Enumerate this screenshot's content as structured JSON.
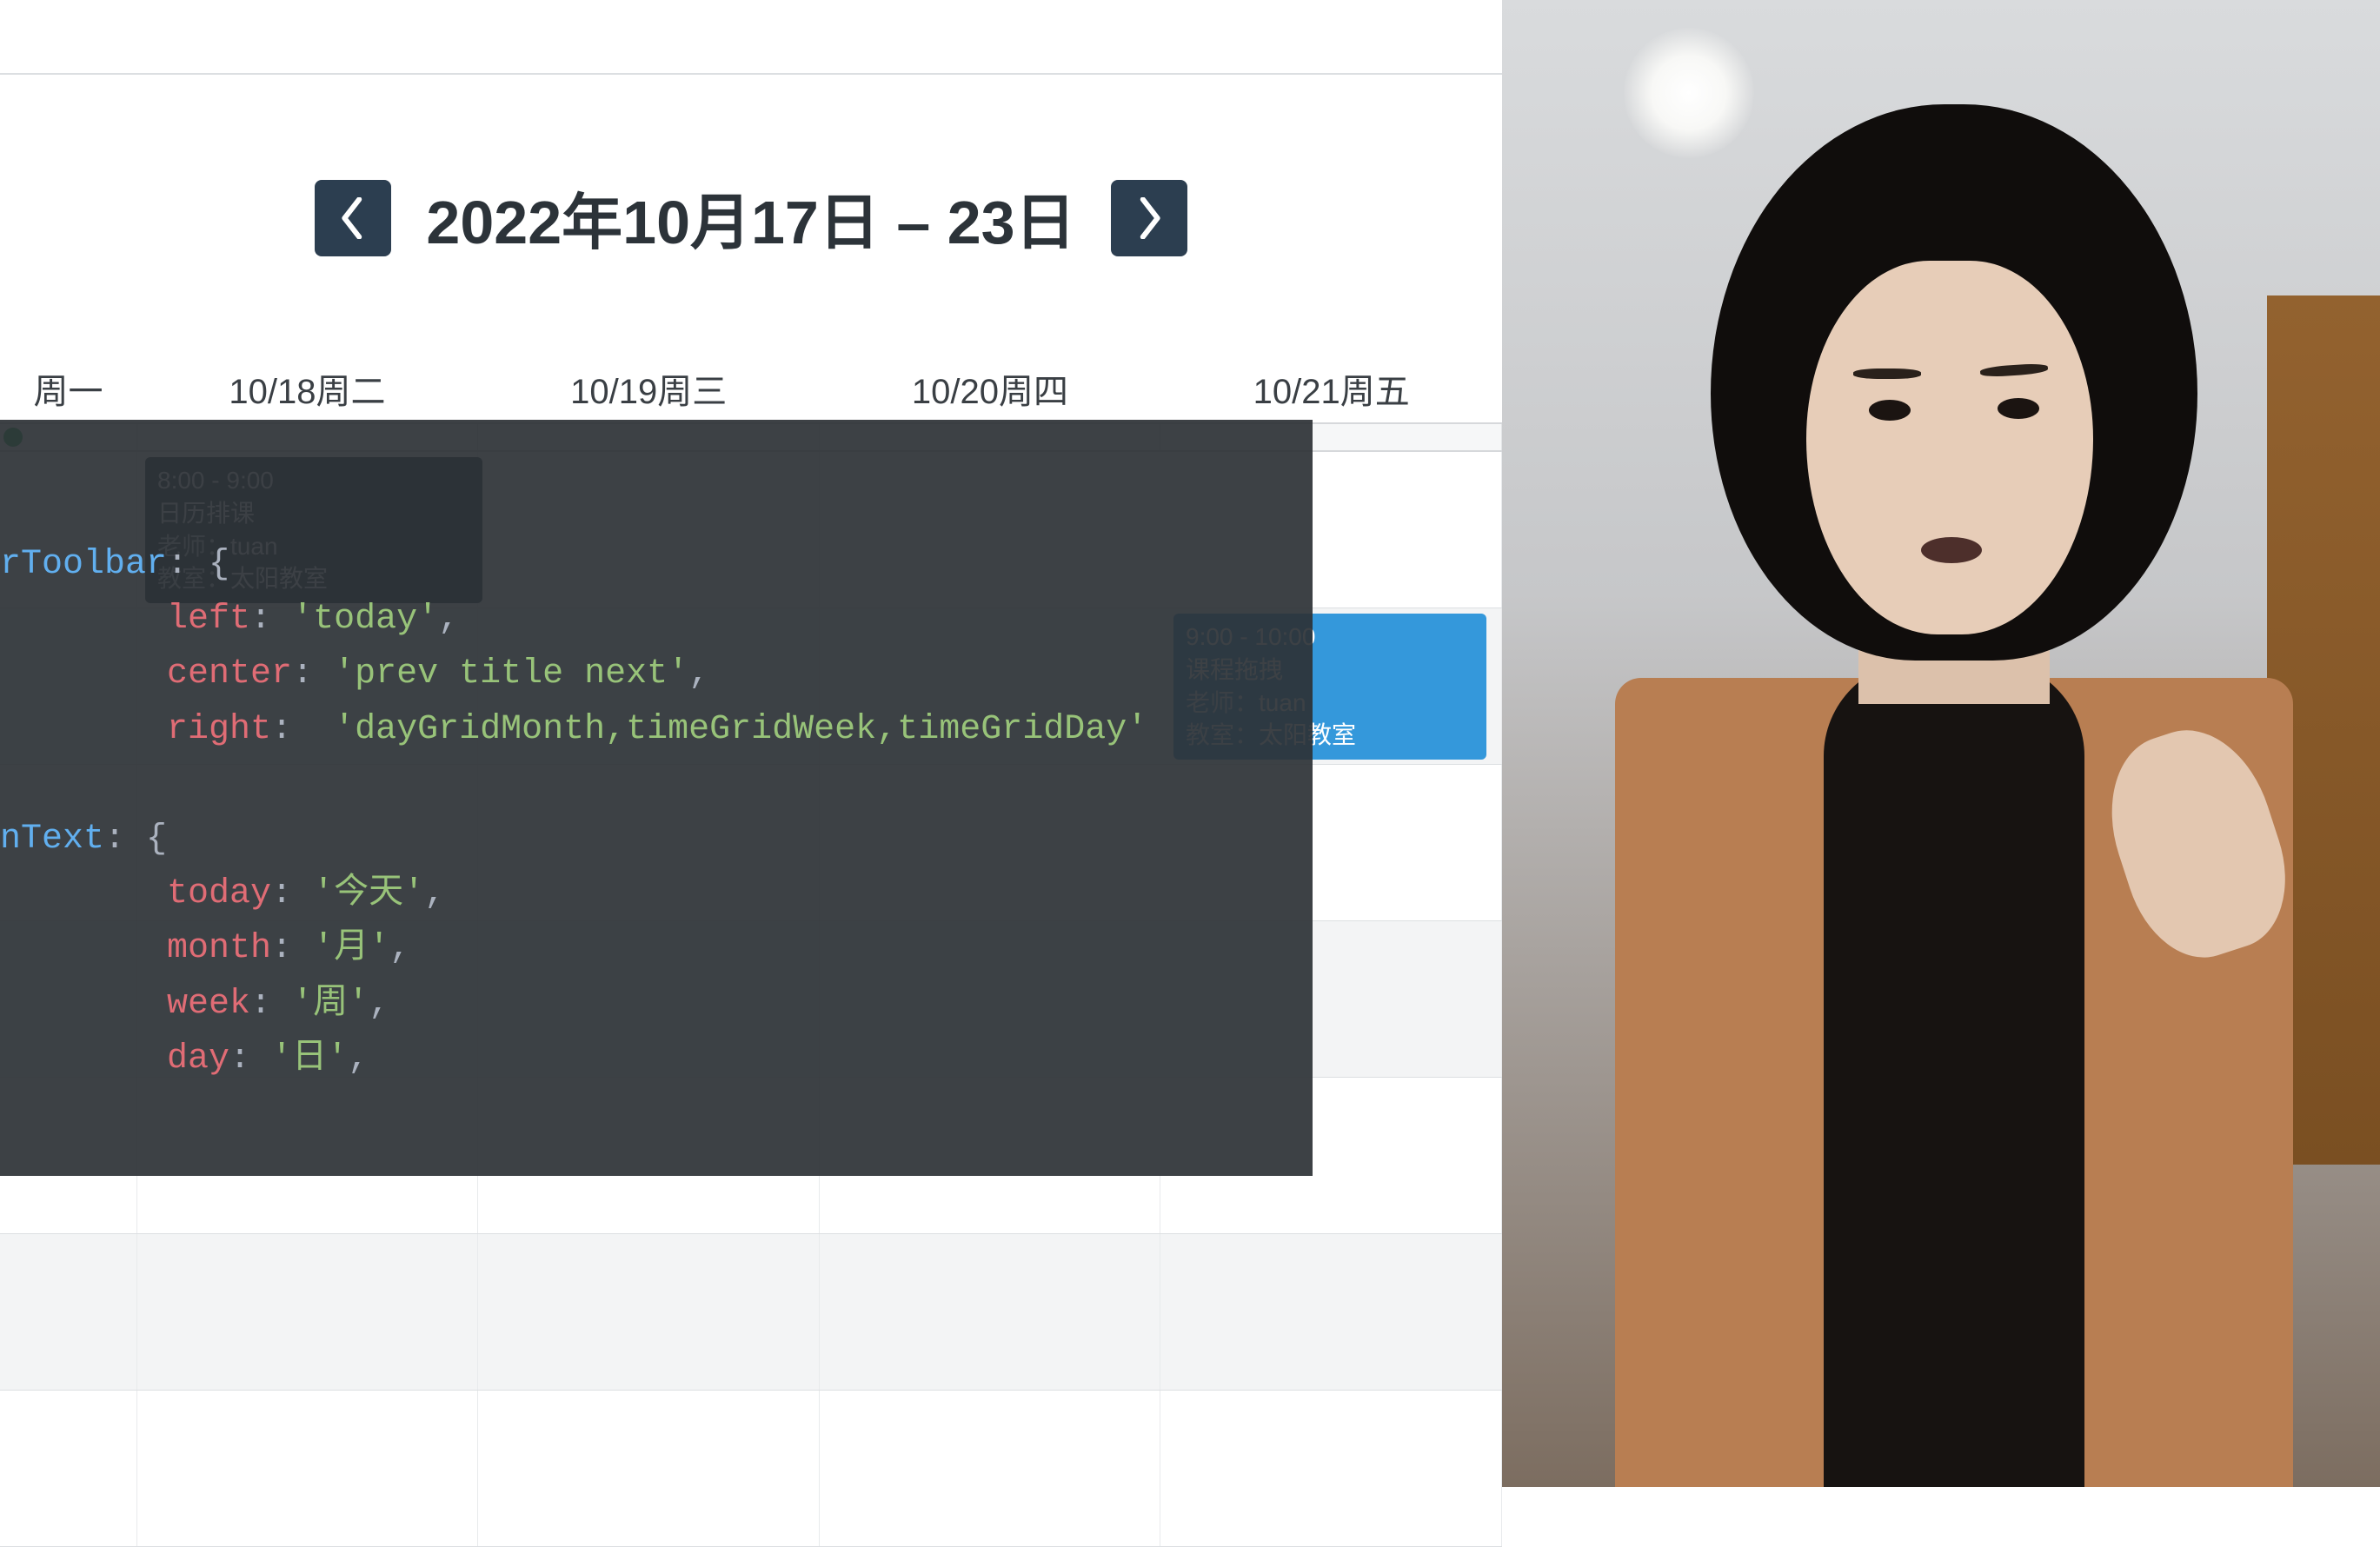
{
  "header": {
    "title": "2022年10月17日 – 23日"
  },
  "days": {
    "d0": "周一",
    "d1": "10/18周二",
    "d2": "10/19周三",
    "d3": "10/20周四",
    "d4": "10/21周五"
  },
  "event1": {
    "time": "8:00 - 9:00",
    "title": "日历排课",
    "teacher_label": "老师：",
    "teacher": "tuan",
    "room_label": "教室：",
    "room": "太阳教室"
  },
  "event2": {
    "time": "9:00 - 10:00",
    "title": "课程拖拽",
    "teacher_label": "老师：",
    "teacher": "tuan",
    "room_label": "教室：",
    "room": "太阳教室"
  },
  "code": {
    "toolbar_key": "rToolbar",
    "brace_open": ": {",
    "left_key": "left",
    "left_val": "'today'",
    "center_key": "center",
    "center_val": "'prev title next'",
    "right_key": "right",
    "right_val": "'dayGridMonth,timeGridWeek,timeGridDay'",
    "ntext_key": "nText",
    "today_key": "today",
    "today_val": "'今天'",
    "month_key": "month",
    "month_val": "'月'",
    "week_key": "week",
    "week_val": "'周'",
    "day_key": "day",
    "day_val": "'日'"
  }
}
